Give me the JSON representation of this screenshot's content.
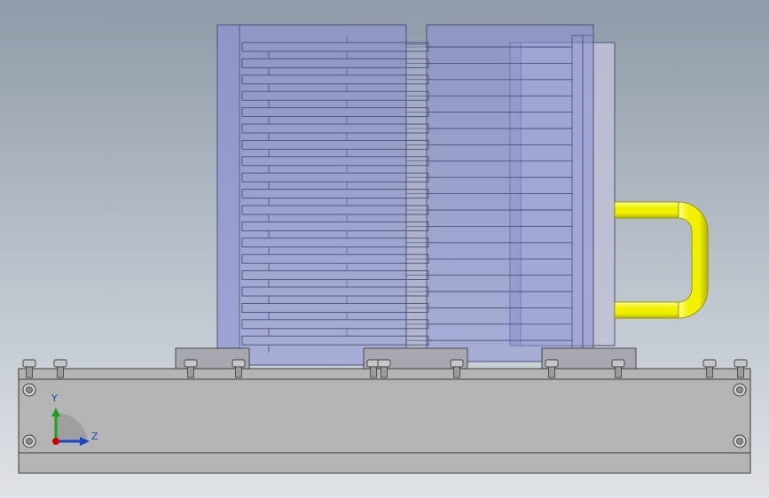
{
  "view": {
    "background_top": "#8f9aa8",
    "background_bottom": "#dfe3e7"
  },
  "colors": {
    "heatsink_fill": "#8b92d6",
    "heatsink_fill_alpha": 0.55,
    "heatsink_stroke": "#4b4f7a",
    "block_fill": "#b4b4b4",
    "block_stroke": "#3c3c3c",
    "pipe_main": "#f0f000",
    "pipe_shadow": "#b5b500",
    "pipe_highlight": "#ffff8a",
    "triad_x": "#d40000",
    "triad_y": "#1ca11c",
    "triad_z": "#1747c8",
    "triad_label": "#1747c8"
  },
  "triad": {
    "icon": "axis-triad-icon",
    "labels": {
      "y": "Y",
      "z": "Z"
    }
  }
}
